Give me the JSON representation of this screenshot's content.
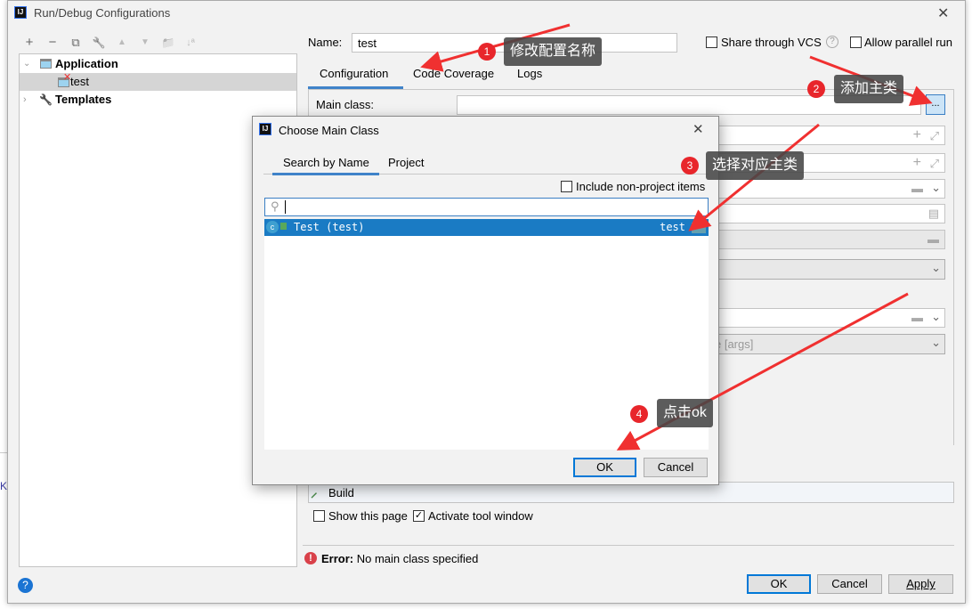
{
  "window": {
    "title": "Run/Debug Configurations",
    "close": "✕",
    "side_text": "K"
  },
  "toolbar": {
    "add": "+",
    "remove": "−",
    "copy": "⧉",
    "edit": "🔧",
    "up": "▲",
    "down": "▼",
    "folder": "📁",
    "sort": "↓ª"
  },
  "tree": {
    "items": [
      {
        "label": "Application",
        "expanded": true
      },
      {
        "label": "test",
        "selected": true,
        "error": true
      },
      {
        "label": "Templates",
        "expanded": false
      }
    ]
  },
  "name": {
    "label": "Name:",
    "value": "test"
  },
  "share_vcs": {
    "label": "Share through VCS",
    "checked": false,
    "help": "?"
  },
  "allow_parallel": {
    "label": "Allow parallel run",
    "checked": false
  },
  "tabs": [
    {
      "label": "Configuration",
      "active": true
    },
    {
      "label": "Code Coverage"
    },
    {
      "label": "Logs"
    }
  ],
  "main_class": {
    "label": "Main class:",
    "value": "",
    "browse": "..."
  },
  "hidden_field_text": "e [args]",
  "before_launch": {
    "item": "Build"
  },
  "show_page": {
    "label": "Show this page",
    "checked": false
  },
  "activate_tool": {
    "label": "Activate tool window",
    "checked": true
  },
  "error": {
    "prefix": "Error:",
    "message": "No main class specified"
  },
  "buttons": {
    "ok": "OK",
    "cancel": "Cancel",
    "apply": "Apply",
    "help": "?"
  },
  "modal": {
    "title": "Choose Main Class",
    "close": "✕",
    "tabs": [
      {
        "label": "Search by Name",
        "active": true
      },
      {
        "label": "Project"
      }
    ],
    "include_non_project": {
      "label": "Include non-project items",
      "checked": false
    },
    "search": {
      "value": "",
      "placeholder": ""
    },
    "results": [
      {
        "label": "Test (test)",
        "module": "test",
        "selected": true
      }
    ],
    "ok": "OK",
    "cancel": "Cancel"
  },
  "annotations": [
    {
      "num": "1",
      "text": "修改配置名称"
    },
    {
      "num": "2",
      "text": "添加主类"
    },
    {
      "num": "3",
      "text": "选择对应主类"
    },
    {
      "num": "4",
      "text": "点击ok"
    }
  ],
  "colors": {
    "accent": "#1a7bc4",
    "selection": "#d5d5d5",
    "annotation_red": "#e8262b",
    "error": "#d9414a"
  }
}
